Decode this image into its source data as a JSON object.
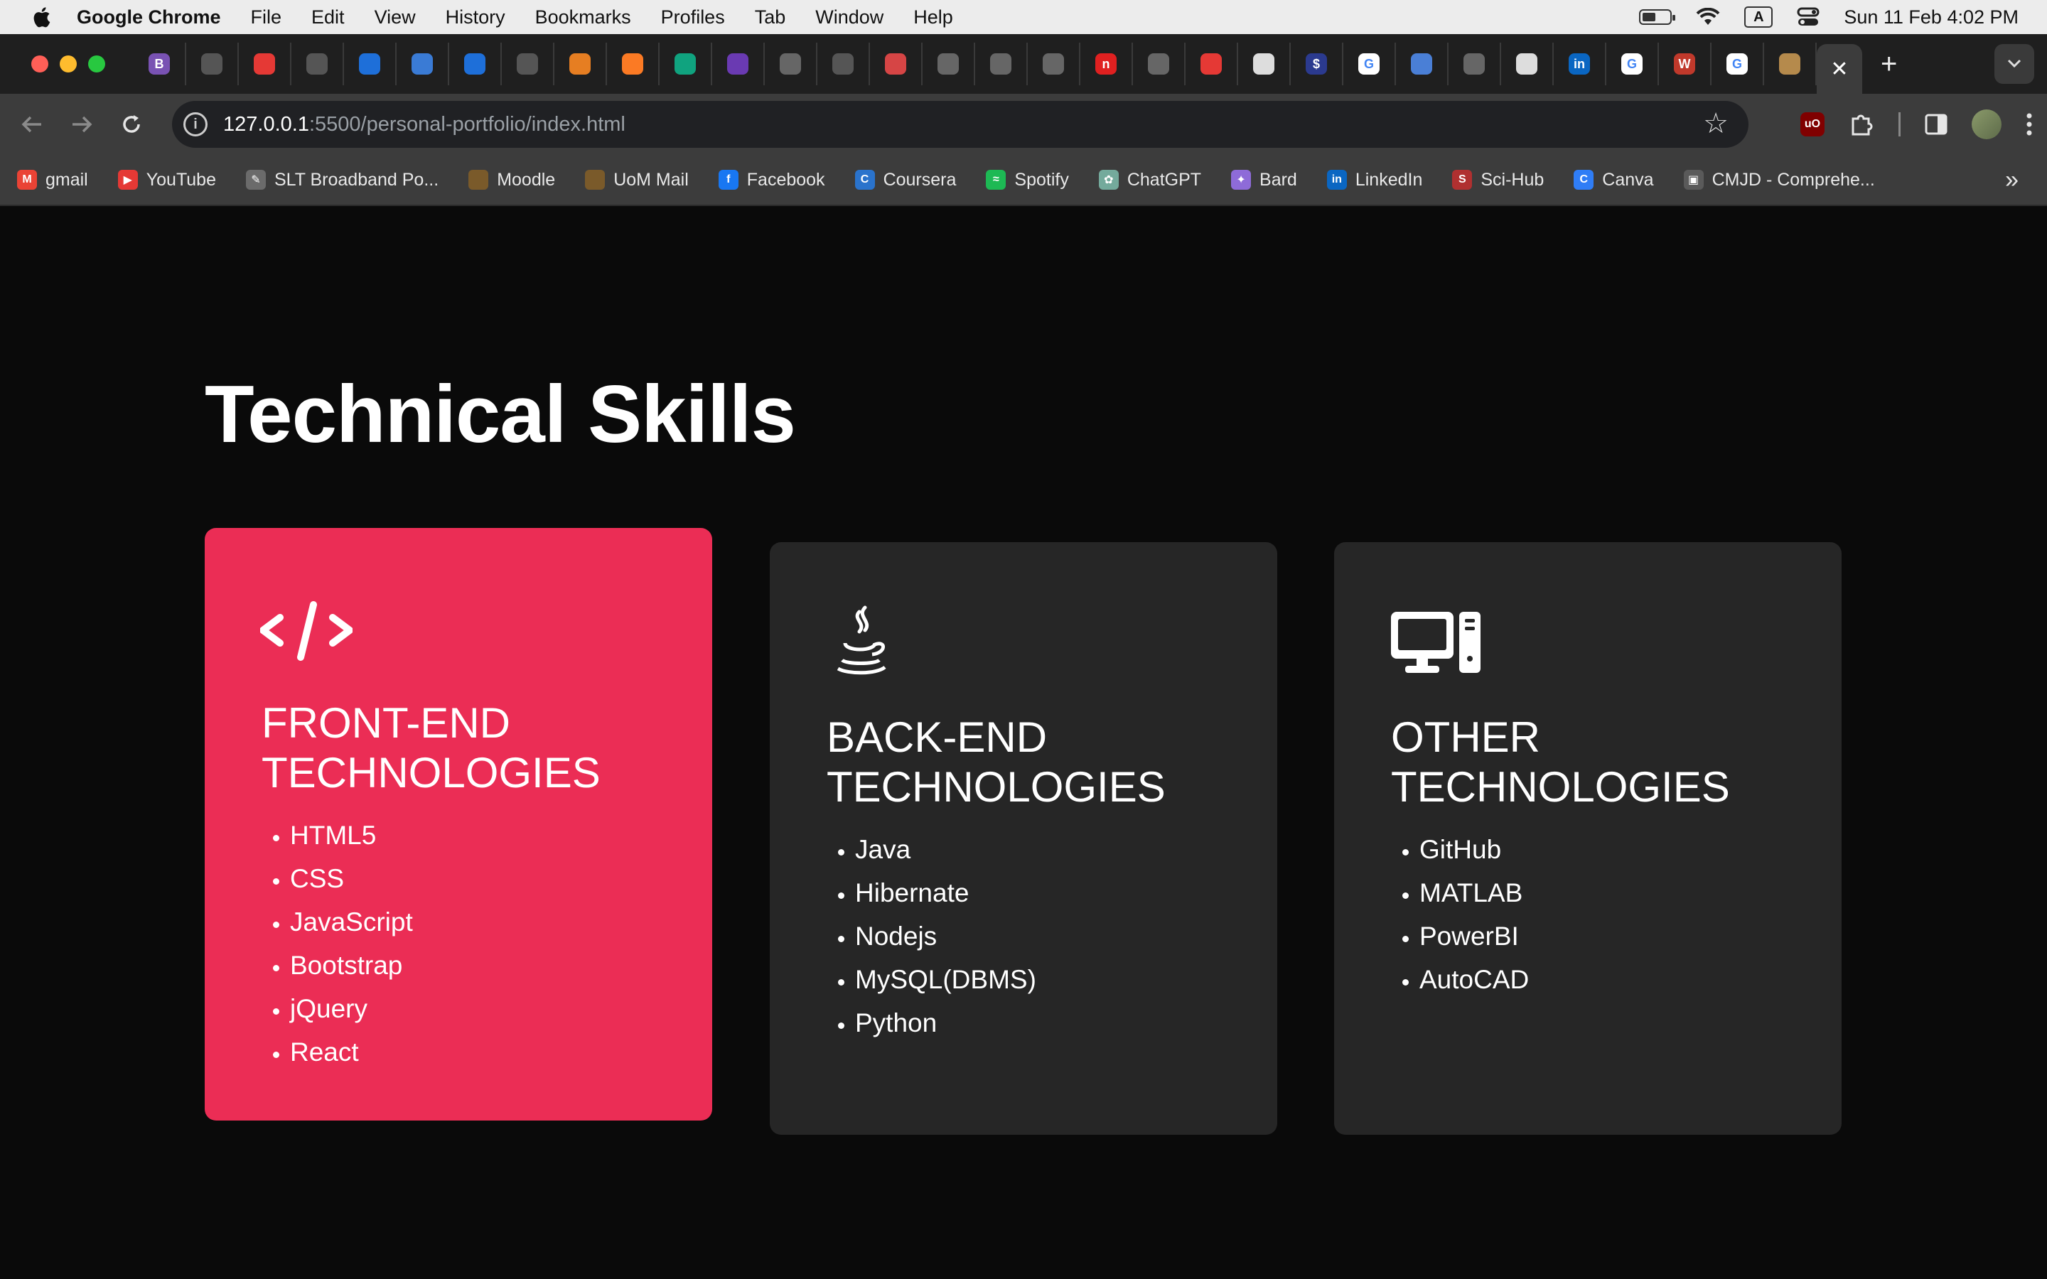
{
  "menubar": {
    "app_name": "Google Chrome",
    "items": [
      "File",
      "Edit",
      "View",
      "History",
      "Bookmarks",
      "Profiles",
      "Tab",
      "Window",
      "Help"
    ],
    "input_indicator": "A",
    "datetime": "Sun 11 Feb  4:02 PM"
  },
  "tabs": {
    "favicons": [
      {
        "icon": "bootstrap-icon",
        "color": "#7952b3",
        "glyph": "B"
      },
      {
        "icon": "github-icon",
        "color": "#555555",
        "glyph": ""
      },
      {
        "icon": "youtube-icon",
        "color": "#e53935",
        "glyph": ""
      },
      {
        "icon": "github-icon",
        "color": "#555555",
        "glyph": ""
      },
      {
        "icon": "mui-icon",
        "color": "#1e6fd9",
        "glyph": ""
      },
      {
        "icon": "react-icon",
        "color": "#3a7bd5",
        "glyph": ""
      },
      {
        "icon": "mui-icon",
        "color": "#1e6fd9",
        "glyph": ""
      },
      {
        "icon": "github-icon",
        "color": "#555555",
        "glyph": ""
      },
      {
        "icon": "diamond-icon",
        "color": "#e67e22",
        "glyph": ""
      },
      {
        "icon": "xampp-icon",
        "color": "#fb7a24",
        "glyph": ""
      },
      {
        "icon": "chatgpt-icon",
        "color": "#10a37f",
        "glyph": ""
      },
      {
        "icon": "purple-circle-icon",
        "color": "#6a3ab2",
        "glyph": ""
      },
      {
        "icon": "globe-icon",
        "color": "#666666",
        "glyph": ""
      },
      {
        "icon": "react-icon",
        "color": "#555555",
        "glyph": ""
      },
      {
        "icon": "image-icon",
        "color": "#d64545",
        "glyph": ""
      },
      {
        "icon": "circle-icon",
        "color": "#666666",
        "glyph": ""
      },
      {
        "icon": "circle-icon",
        "color": "#666666",
        "glyph": ""
      },
      {
        "icon": "circle-icon",
        "color": "#666666",
        "glyph": ""
      },
      {
        "icon": "n-icon",
        "color": "#e02020",
        "glyph": "n"
      },
      {
        "icon": "circle-icon",
        "color": "#666666",
        "glyph": ""
      },
      {
        "icon": "youtube-icon",
        "color": "#e53935",
        "glyph": ""
      },
      {
        "icon": "github-icon",
        "color": "#dddddd",
        "glyph": ""
      },
      {
        "icon": "dollar-icon",
        "color": "#2b3a8f",
        "glyph": "$"
      },
      {
        "icon": "google-icon",
        "color": "#ffffff",
        "glyph": "G"
      },
      {
        "icon": "window-icon",
        "color": "#4a7fd6",
        "glyph": ""
      },
      {
        "icon": "globe-icon",
        "color": "#666666",
        "glyph": ""
      },
      {
        "icon": "github-icon",
        "color": "#dddddd",
        "glyph": ""
      },
      {
        "icon": "linkedin-icon",
        "color": "#0a66c2",
        "glyph": "in"
      },
      {
        "icon": "google-icon",
        "color": "#ffffff",
        "glyph": "G"
      },
      {
        "icon": "wsc-icon",
        "color": "#c0392b",
        "glyph": "W"
      },
      {
        "icon": "google-icon",
        "color": "#ffffff",
        "glyph": "G"
      },
      {
        "icon": "crest-icon",
        "color": "#b58a4c",
        "glyph": ""
      }
    ],
    "active_close": "✕",
    "new_tab": "+"
  },
  "toolbar": {
    "url_host": "127.0.0.1",
    "url_path": ":5500/personal-portfolio/index.html"
  },
  "bookmarks": {
    "items": [
      {
        "label": "gmail",
        "icon": "gmail-icon",
        "color": "#ea4335",
        "glyph": "M"
      },
      {
        "label": "YouTube",
        "icon": "youtube-icon",
        "color": "#e53935",
        "glyph": "▶"
      },
      {
        "label": "SLT Broadband Po...",
        "icon": "slt-icon",
        "color": "#6b6b6b",
        "glyph": "✎"
      },
      {
        "label": "Moodle",
        "icon": "moodle-icon",
        "color": "#7a5a2a",
        "glyph": ""
      },
      {
        "label": "UoM Mail",
        "icon": "uom-icon",
        "color": "#7a5a2a",
        "glyph": ""
      },
      {
        "label": "Facebook",
        "icon": "facebook-icon",
        "color": "#1877f2",
        "glyph": "f"
      },
      {
        "label": "Coursera",
        "icon": "coursera-icon",
        "color": "#2a73cc",
        "glyph": "C"
      },
      {
        "label": "Spotify",
        "icon": "spotify-icon",
        "color": "#1db954",
        "glyph": "≈"
      },
      {
        "label": "ChatGPT",
        "icon": "chatgpt-icon",
        "color": "#74aa9c",
        "glyph": "✿"
      },
      {
        "label": "Bard",
        "icon": "bard-icon",
        "color": "#8e6bd8",
        "glyph": "✦"
      },
      {
        "label": "LinkedIn",
        "icon": "linkedin-icon",
        "color": "#0a66c2",
        "glyph": "in"
      },
      {
        "label": "Sci-Hub",
        "icon": "scihub-icon",
        "color": "#b03030",
        "glyph": "S"
      },
      {
        "label": "Canva",
        "icon": "canva-icon",
        "color": "#2f7df6",
        "glyph": "C"
      },
      {
        "label": "CMJD - Comprehe...",
        "icon": "contact-card-icon",
        "color": "#5a5a5a",
        "glyph": "▣"
      }
    ],
    "more": "»"
  },
  "page": {
    "title": "Technical Skills",
    "cards": [
      {
        "icon": "code-icon",
        "title": "FRONT-END TECHNOLOGIES",
        "items": [
          "HTML5",
          "CSS",
          "JavaScript",
          "Bootstrap",
          "jQuery",
          "React"
        ],
        "color": "#eb2d55"
      },
      {
        "icon": "java-icon",
        "title": "BACK-END TECHNOLOGIES",
        "items": [
          "Java",
          "Hibernate",
          "Nodejs",
          "MySQL(DBMS)",
          "Python"
        ],
        "color": "#262626"
      },
      {
        "icon": "computer-icon",
        "title": "OTHER TECHNOLOGIES",
        "items": [
          "GitHub",
          "MATLAB",
          "PowerBI",
          "AutoCAD"
        ],
        "color": "#262626"
      }
    ]
  }
}
